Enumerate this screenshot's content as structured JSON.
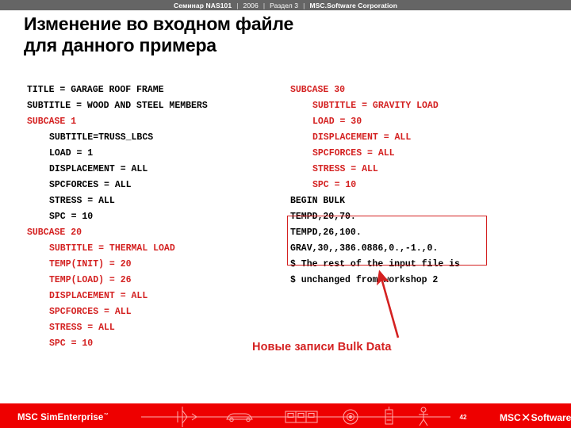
{
  "header": {
    "seminar": "Семинар NAS101",
    "sep": "|",
    "year": "2006",
    "section": "Раздел  3",
    "company": "MSC.Software Corporation"
  },
  "title": {
    "line1": "Изменение во входном файле",
    "line2": "для данного примера"
  },
  "colors": {
    "accent_red": "#d42121",
    "footer_red": "#ee0000",
    "header_gray": "#656565"
  },
  "code_left": [
    {
      "text": "TITLE = GARAGE ROOF FRAME",
      "color": "black",
      "indent": 0
    },
    {
      "text": "SUBTITLE = WOOD AND STEEL MEMBERS",
      "color": "black",
      "indent": 0
    },
    {
      "text": "SUBCASE 1",
      "color": "red",
      "indent": 0
    },
    {
      "text": "SUBTITLE=TRUSS_LBCS",
      "color": "black",
      "indent": 1
    },
    {
      "text": "LOAD = 1",
      "color": "black",
      "indent": 1
    },
    {
      "text": "DISPLACEMENT = ALL",
      "color": "black",
      "indent": 1
    },
    {
      "text": "SPCFORCES = ALL",
      "color": "black",
      "indent": 1
    },
    {
      "text": "STRESS = ALL",
      "color": "black",
      "indent": 1
    },
    {
      "text": "SPC = 10",
      "color": "black",
      "indent": 1
    },
    {
      "text": "SUBCASE 20",
      "color": "red",
      "indent": 0
    },
    {
      "text": "SUBTITLE = THERMAL LOAD",
      "color": "red",
      "indent": 1
    },
    {
      "text": "TEMP(INIT) = 20",
      "color": "red",
      "indent": 1
    },
    {
      "text": "TEMP(LOAD) = 26",
      "color": "red",
      "indent": 1
    },
    {
      "text": "DISPLACEMENT = ALL",
      "color": "red",
      "indent": 1
    },
    {
      "text": "SPCFORCES = ALL",
      "color": "red",
      "indent": 1
    },
    {
      "text": "STRESS = ALL",
      "color": "red",
      "indent": 1
    },
    {
      "text": "SPC = 10",
      "color": "red",
      "indent": 1
    }
  ],
  "code_right": [
    {
      "text": "SUBCASE 30",
      "color": "red",
      "indent": 0
    },
    {
      "text": "SUBTITLE = GRAVITY LOAD",
      "color": "red",
      "indent": 1
    },
    {
      "text": "LOAD = 30",
      "color": "red",
      "indent": 1
    },
    {
      "text": "DISPLACEMENT = ALL",
      "color": "red",
      "indent": 1
    },
    {
      "text": "SPCFORCES = ALL",
      "color": "red",
      "indent": 1
    },
    {
      "text": "STRESS = ALL",
      "color": "red",
      "indent": 1
    },
    {
      "text": "SPC = 10",
      "color": "red",
      "indent": 1
    },
    {
      "text": "BEGIN BULK",
      "color": "black",
      "indent": 0
    },
    {
      "text": "TEMPD,20,70.",
      "color": "black",
      "indent": 0
    },
    {
      "text": "TEMPD,26,100.",
      "color": "black",
      "indent": 0
    },
    {
      "text": "GRAV,30,,386.0886,0.,-1.,0.",
      "color": "black",
      "indent": 0
    },
    {
      "text": "$ The rest of the input file is",
      "color": "black",
      "indent": 0
    },
    {
      "text": "$ unchanged from workshop 2",
      "color": "black",
      "indent": 0
    }
  ],
  "annotation": {
    "caption": "Новые записи Bulk Data"
  },
  "footer": {
    "brand": "MSC SimEnterprise",
    "brand_tm": "™",
    "page": "42",
    "logo_left": "MSC",
    "logo_right": "Software",
    "logo_tm": "®",
    "icons": [
      "airplane-icon",
      "car-icon",
      "train-icon",
      "disc-icon",
      "phone-icon",
      "person-icon"
    ]
  }
}
